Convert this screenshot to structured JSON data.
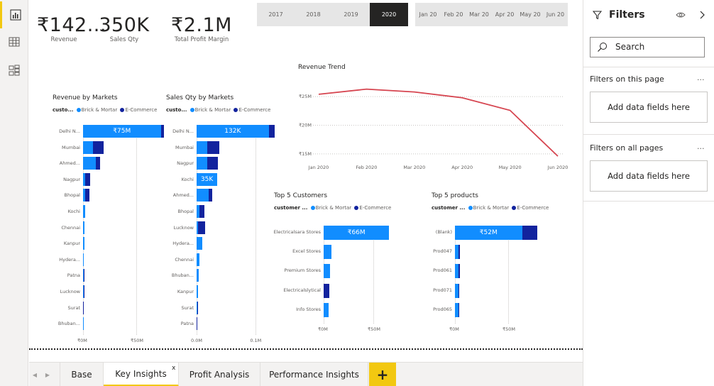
{
  "kpis": [
    {
      "value": "₹142...",
      "label": "Revenue"
    },
    {
      "value": "350K",
      "label": "Sales Qty"
    },
    {
      "value": "₹2.1M",
      "label": "Total Profit Margin"
    }
  ],
  "year_slicer": [
    "2017",
    "2018",
    "2019",
    "2020"
  ],
  "year_selected": "2020",
  "month_slicer": [
    "Jan 20",
    "Feb 20",
    "Mar 20",
    "Apr 20",
    "May 20",
    "Jun 20"
  ],
  "legend": {
    "field_short": "custo...",
    "field": "customer ...",
    "brick": "Brick & Mortar",
    "ecom": "E-Commerce"
  },
  "colors": {
    "brick": "#118dff",
    "ecom": "#12239e",
    "trend": "#d64550",
    "accent": "#f2c811"
  },
  "visuals": {
    "revenue_by_markets": "Revenue by Markets",
    "sales_qty_by_markets": "Sales Qty by Markets",
    "revenue_trend": "Revenue Trend",
    "top5_customers": "Top 5 Customers",
    "top5_products": "Top 5 products"
  },
  "chart_data": [
    {
      "id": "rev_mkt",
      "type": "bar",
      "title": "Revenue by Markets",
      "categories": [
        "Delhi N...",
        "Mumbai",
        "Ahmed...",
        "Nagpur",
        "Bhopal",
        "Kochi",
        "Chennai",
        "Kanpur",
        "Hydera...",
        "Patna",
        "Lucknow",
        "Surat",
        "Bhuban..."
      ],
      "series": [
        {
          "name": "Brick & Mortar",
          "values": [
            73,
            9,
            12,
            2,
            2,
            2,
            1.5,
            1,
            0.8,
            0.4,
            0.4,
            0.2,
            0.1
          ]
        },
        {
          "name": "E-Commerce",
          "values": [
            3,
            10,
            4,
            4.5,
            4,
            0,
            0,
            0,
            0,
            0.4,
            0.3,
            0.1,
            0
          ]
        }
      ],
      "data_labels": [
        "₹75M",
        "",
        "",
        "",
        "",
        "",
        "",
        "",
        "",
        "",
        "",
        "",
        ""
      ],
      "ticks": [
        "₹0M",
        "₹50M"
      ],
      "xlim": [
        0,
        100
      ]
    },
    {
      "id": "qty_mkt",
      "type": "bar",
      "title": "Sales Qty by Markets",
      "categories": [
        "Delhi N...",
        "Mumbai",
        "Nagpur",
        "Kochi",
        "Ahmed...",
        "Bhopal",
        "Lucknow",
        "Hydera...",
        "Chennai",
        "Bhuban...",
        "Kanpur",
        "Surat",
        "Patna"
      ],
      "series": [
        {
          "name": "Brick & Mortar",
          "values": [
            122,
            18,
            18,
            35,
            20,
            5,
            2,
            10,
            5,
            3,
            2,
            1,
            0.5
          ]
        },
        {
          "name": "E-Commerce",
          "values": [
            10,
            20,
            18,
            0,
            7,
            8,
            13,
            0,
            0,
            0,
            0,
            0.5,
            0.5
          ]
        }
      ],
      "data_labels": [
        "132K",
        "",
        "",
        "35K",
        "",
        "",
        "",
        "",
        "",
        "",
        "",
        "",
        ""
      ],
      "ticks": [
        "0.0M",
        "0.1M"
      ],
      "xlim": [
        0,
        180
      ]
    },
    {
      "id": "trend",
      "type": "line",
      "title": "Revenue Trend",
      "x": [
        "Jan 2020",
        "Feb 2020",
        "Mar 2020",
        "Apr 2020",
        "May 2020",
        "Jun 2020"
      ],
      "series": [
        {
          "values": [
            25.4,
            26.3,
            25.8,
            24.8,
            22.6,
            14.6
          ]
        }
      ],
      "yticks": [
        "₹15M",
        "₹20M",
        "₹25M"
      ],
      "ylim": [
        14,
        26.5
      ]
    },
    {
      "id": "top_cust",
      "type": "bar",
      "title": "Top 5 Customers",
      "categories": [
        "Electricalsara Stores",
        "Excel Stores",
        "Premium Stores",
        "Electricalslytical",
        "Info Stores"
      ],
      "series": [
        {
          "name": "Brick & Mortar",
          "values": [
            66,
            8,
            6.5,
            0,
            5
          ]
        },
        {
          "name": "E-Commerce",
          "values": [
            0,
            0,
            0,
            6,
            0
          ]
        }
      ],
      "data_labels": [
        "₹66M",
        "",
        "",
        "",
        ""
      ],
      "ticks": [
        "₹0M",
        "₹50M"
      ],
      "xlim": [
        0,
        100
      ]
    },
    {
      "id": "top_prod",
      "type": "bar",
      "title": "Top 5 products",
      "categories": [
        "(Blank)",
        "Prod047",
        "Prod061",
        "Prod071",
        "Prod065"
      ],
      "series": [
        {
          "name": "Brick & Mortar",
          "values": [
            63,
            3,
            3,
            3,
            3
          ]
        },
        {
          "name": "E-Commerce",
          "values": [
            14,
            1.5,
            1.5,
            1,
            1
          ]
        }
      ],
      "data_labels": [
        "₹52M",
        "",
        "",
        "",
        ""
      ],
      "ticks": [
        "₹0M",
        "₹50M"
      ],
      "xlim": [
        0,
        100
      ]
    }
  ],
  "filters": {
    "title": "Filters",
    "search": "Search",
    "on_page": "Filters on this page",
    "on_all": "Filters on all pages",
    "add_fields": "Add data fields here",
    "more": "..."
  },
  "tabs": [
    "Base",
    "Key Insights",
    "Profit Analysis",
    "Performance Insights"
  ],
  "active_tab": "Key Insights",
  "tab_add": "+",
  "tab_close": "x"
}
